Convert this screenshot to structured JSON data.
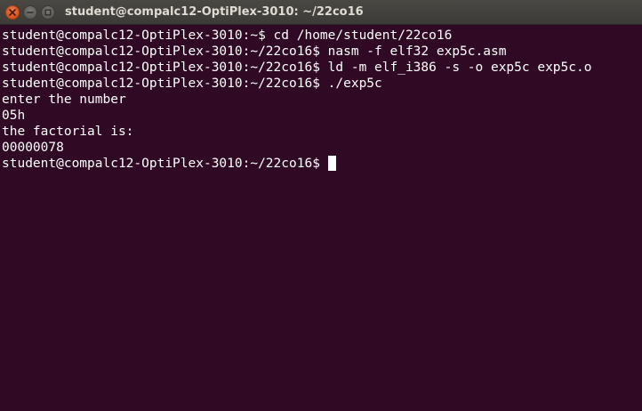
{
  "window": {
    "title": "student@compalc12-OptiPlex-3010: ~/22co16",
    "controls": {
      "close_icon": "close-icon",
      "minimize_icon": "minimize-icon",
      "maximize_icon": "maximize-icon"
    }
  },
  "terminal": {
    "colors": {
      "background": "#300a24",
      "foreground": "#ffffff",
      "titlebar": "#3c3b37",
      "close_button": "#e05a24"
    },
    "lines": [
      "student@compalc12-OptiPlex-3010:~$ cd /home/student/22co16",
      "student@compalc12-OptiPlex-3010:~/22co16$ nasm -f elf32 exp5c.asm",
      "student@compalc12-OptiPlex-3010:~/22co16$ ld -m elf_i386 -s -o exp5c exp5c.o",
      "student@compalc12-OptiPlex-3010:~/22co16$ ./exp5c",
      "enter the number",
      "05h",
      "the factorial is:",
      "00000078"
    ],
    "prompt": "student@compalc12-OptiPlex-3010:~/22co16$ "
  }
}
